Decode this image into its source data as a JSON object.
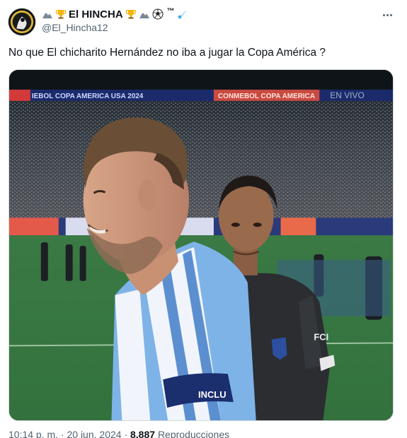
{
  "author": {
    "display_name": "El HINCHA",
    "trademark": "™",
    "handle": "@El_Hincha12",
    "name_emoji_icons": [
      "mountain-icon",
      "trophy-icon",
      "trophy-icon",
      "mountain-icon",
      "soccer-ball-icon"
    ],
    "suffix_icon": "comet-icon"
  },
  "tweet": {
    "text": "No que El chicharito Hernández no iba a jugar la Copa América ?"
  },
  "media": {
    "banner_left": "IEBOL COPA AMERICA USA 2024",
    "banner_right": "CONMEBOL COPA AMERICA",
    "banner_far_right": "EN VIVO",
    "captain_band_text": "INCLU",
    "ref_shirt_text": "FCI"
  },
  "footer": {
    "time_date": "10:14 p. m. · 20 jun. 2024 ·",
    "views_count": "8.887",
    "views_label": "Reproducciones"
  },
  "colors": {
    "accent": "#1d9bf0",
    "text_secondary": "#536471",
    "border": "#cfd9de"
  }
}
